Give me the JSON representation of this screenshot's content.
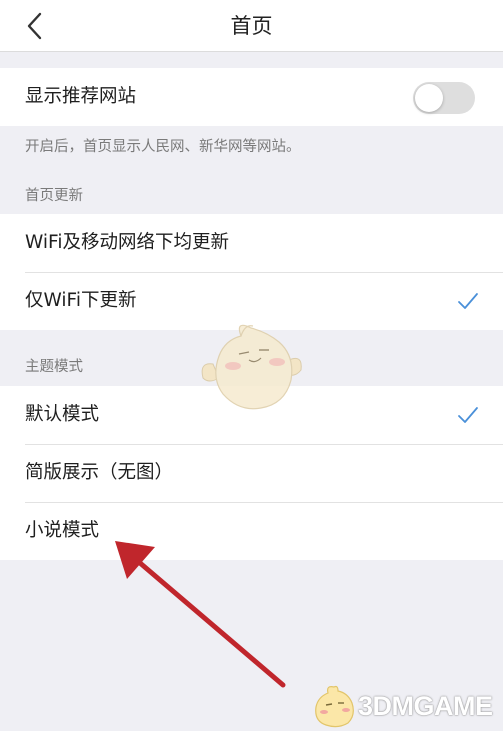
{
  "header": {
    "title": "首页",
    "back_icon": "chevron-left-icon"
  },
  "recommend": {
    "label": "显示推荐网站",
    "toggle_on": false,
    "note": "开启后，首页显示人民网、新华网等网站。"
  },
  "update": {
    "section_title": "首页更新",
    "options": [
      {
        "label": "WiFi及移动网络下均更新",
        "checked": false
      },
      {
        "label": "仅WiFi下更新",
        "checked": true
      }
    ]
  },
  "theme": {
    "section_title": "主题模式",
    "options": [
      {
        "label": "默认模式",
        "checked": true
      },
      {
        "label": "简版展示（无图）",
        "checked": false
      },
      {
        "label": "小说模式",
        "checked": false
      }
    ]
  },
  "colors": {
    "accent": "#4a90d9",
    "arrow": "#c0262c",
    "background": "#efeff4"
  },
  "watermark": {
    "brand": "3DMGAME"
  }
}
